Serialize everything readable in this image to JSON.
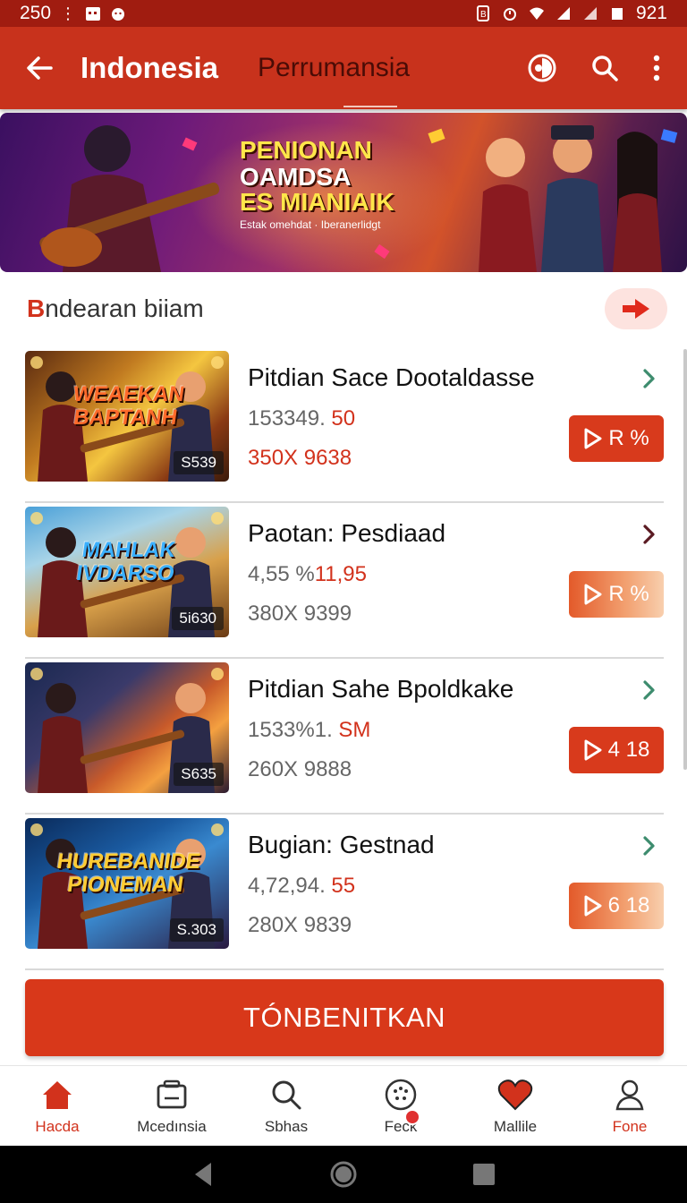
{
  "status_bar": {
    "time": "250",
    "battery": "921"
  },
  "app_bar": {
    "title": "Indonesia",
    "tab": "Perrumansia",
    "icons": [
      "back-arrow-icon",
      "profile-ring-icon",
      "search-icon",
      "more-vertical-icon"
    ]
  },
  "banner": {
    "line1": "PENIONAN",
    "line2": "OAMDSA",
    "line3": "ES MIANIAIK",
    "sub": "Estak omehdat · Iberanerlidgt"
  },
  "section": {
    "title_first": "B",
    "title_rest": "ndearan biiam"
  },
  "items": [
    {
      "name": "Pitdian Sace Dootaldasse",
      "price_gray": "153349.",
      "price_accent": " 50",
      "resolution": "350X 9638",
      "resolution_color": "#d2321c",
      "thumb_title": "WEAEKAN BAPTANH",
      "thumb_badge": "S539",
      "button_label": "R  %",
      "chevron_color": "#3d8c6e",
      "button_style": "solid"
    },
    {
      "name": "Paotan: Pesdiaad",
      "price_gray": "4,55 %",
      "price_accent": "11,95",
      "resolution": "380X 9399",
      "resolution_color": "#666666",
      "thumb_title": "MAHLAK IVDARSO",
      "thumb_badge": "5i630",
      "button_label": "R  %",
      "chevron_color": "#5a1a22",
      "button_style": "light"
    },
    {
      "name": "Pitdian Sahe Bpoldkake",
      "price_gray": "1533%1.",
      "price_accent": " SM",
      "resolution": "260X 9888",
      "resolution_color": "#666666",
      "thumb_title": "",
      "thumb_badge": "S635",
      "button_label": "4 18",
      "chevron_color": "#3d8c6e",
      "button_style": "solid"
    },
    {
      "name": "Bugian: Gestnad",
      "price_gray": "4,72,94.",
      "price_accent": " 55",
      "resolution": "280X 9839",
      "resolution_color": "#666666",
      "thumb_title": "HUREBANIDE PIONEMAN",
      "thumb_badge": "S.303",
      "button_label": "6 18",
      "chevron_color": "#3d8c6e",
      "button_style": "light"
    }
  ],
  "cta": {
    "label": "TÓNBENITKAN"
  },
  "bottom_nav": [
    {
      "label": "Hacda",
      "icon": "home-icon",
      "active": true
    },
    {
      "label": "Mcedınsia",
      "icon": "media-icon",
      "active": false
    },
    {
      "label": "Sbhas",
      "icon": "search-icon",
      "active": false
    },
    {
      "label": "Feck",
      "icon": "dots-circle-icon",
      "active": false
    },
    {
      "label": "Mallile",
      "icon": "heart-icon",
      "active": false
    },
    {
      "label": "Fone",
      "icon": "profile-icon",
      "active": true
    }
  ],
  "colors": {
    "primary": "#c8321c",
    "accent": "#d2321c",
    "status_bar": "#a01c10"
  }
}
